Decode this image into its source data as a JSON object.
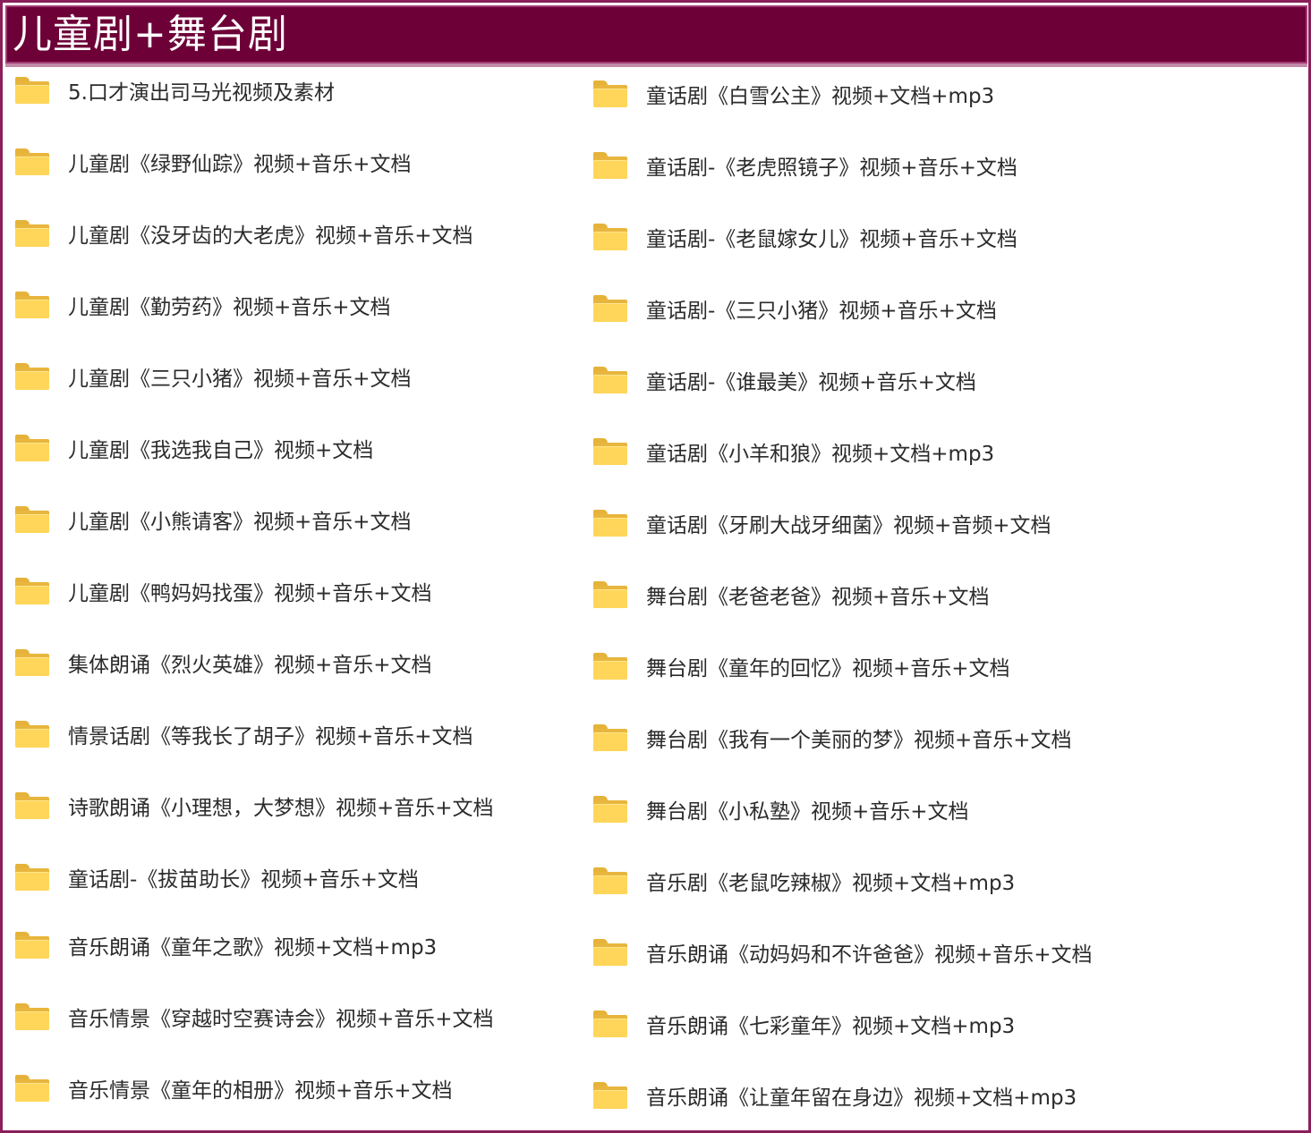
{
  "header": {
    "title": "儿童剧+舞台剧"
  },
  "icon": "folder-icon",
  "left_items": [
    "5.口才演出司马光视频及素材",
    "儿童剧《绿野仙踪》视频+音乐+文档",
    "儿童剧《没牙齿的大老虎》视频+音乐+文档",
    "儿童剧《勤劳药》视频+音乐+文档",
    "儿童剧《三只小猪》视频+音乐+文档",
    "儿童剧《我选我自己》视频+文档",
    "儿童剧《小熊请客》视频+音乐+文档",
    "儿童剧《鸭妈妈找蛋》视频+音乐+文档",
    "集体朗诵《烈火英雄》视频+音乐+文档",
    "情景话剧《等我长了胡子》视频+音乐+文档",
    "诗歌朗诵《小理想，大梦想》视频+音乐+文档",
    "童话剧-《拔苗助长》视频+音乐+文档",
    "音乐朗诵《童年之歌》视频+文档+mp3",
    "音乐情景《穿越时空赛诗会》视频+音乐+文档",
    "音乐情景《童年的相册》视频+音乐+文档"
  ],
  "right_items": [
    "童话剧《白雪公主》视频+文档+mp3",
    "童话剧-《老虎照镜子》视频+音乐+文档",
    "童话剧-《老鼠嫁女儿》视频+音乐+文档",
    "童话剧-《三只小猪》视频+音乐+文档",
    "童话剧-《谁最美》视频+音乐+文档",
    "童话剧《小羊和狼》视频+文档+mp3",
    "童话剧《牙刷大战牙细菌》视频+音频+文档",
    "舞台剧《老爸老爸》视频+音乐+文档",
    "舞台剧《童年的回忆》视频+音乐+文档",
    "舞台剧《我有一个美丽的梦》视频+音乐+文档",
    "舞台剧《小私塾》视频+音乐+文档",
    "音乐剧《老鼠吃辣椒》视频+文档+mp3",
    "音乐朗诵《动妈妈和不许爸爸》视频+音乐+文档",
    "音乐朗诵《七彩童年》视频+文档+mp3",
    "音乐朗诵《让童年留在身边》视频+文档+mp3"
  ],
  "colors": {
    "header_bg": "#6d0037",
    "border": "#8a1f5a",
    "folder": "#ffd65a",
    "text": "#2b2b2b"
  }
}
